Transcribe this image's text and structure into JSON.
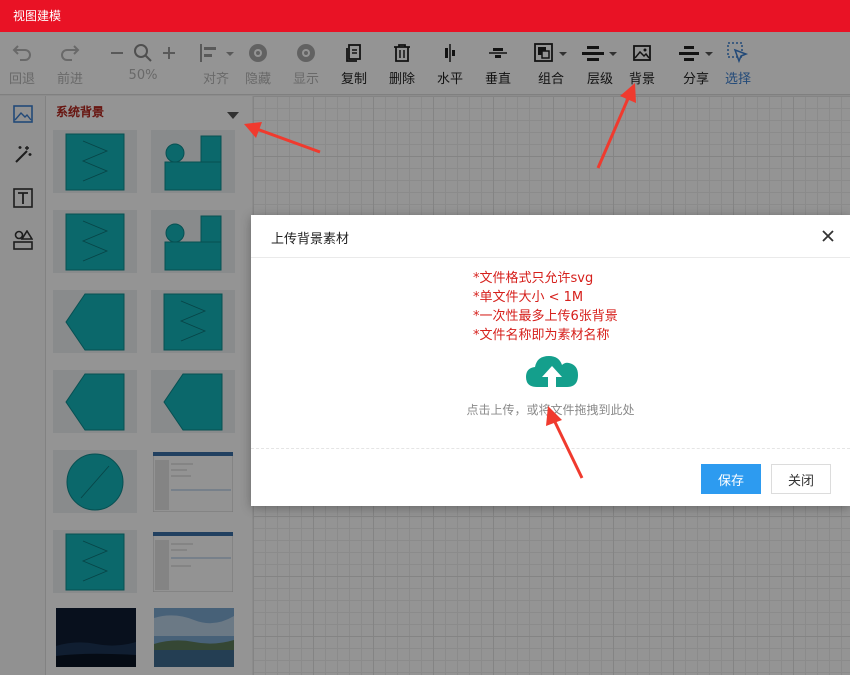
{
  "app": {
    "title": "视图建模"
  },
  "toolbar": {
    "undo": "回退",
    "redo": "前进",
    "zoom": "50%",
    "align": "对齐",
    "hide": "隐藏",
    "show": "显示",
    "copy": "复制",
    "delete": "删除",
    "horizontal": "水平",
    "vertical": "垂直",
    "group": "组合",
    "layer": "层级",
    "background": "背景",
    "distribute": "分享",
    "select": "选择"
  },
  "panel": {
    "title": "系统背景"
  },
  "dialog": {
    "title": "上传背景素材",
    "rules": [
      "*文件格式只允许svg",
      "*单文件大小 < 1M",
      "*一次性最多上传6张背景",
      "*文件名称即为素材名称"
    ],
    "upload_text": "点击上传，或将文件拖拽到此处",
    "save_label": "保存",
    "close_label": "关闭"
  },
  "colors": {
    "titlebar": "#e91225",
    "accent": "#2d9bf0",
    "shape": "#13b3b8",
    "warning": "#d6201c",
    "upload_icon": "#149f8c"
  }
}
